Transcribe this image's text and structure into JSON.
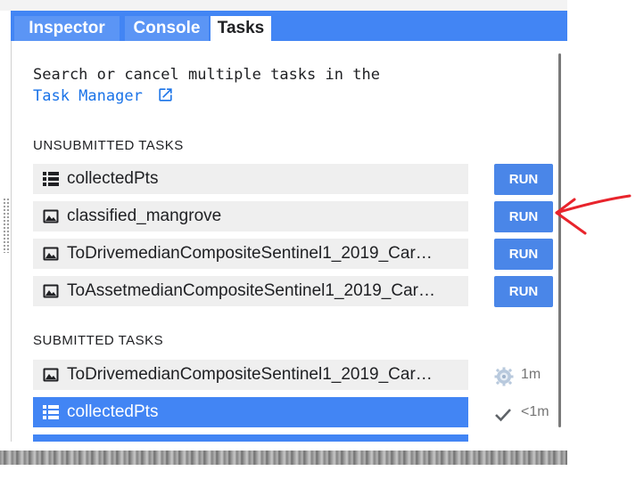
{
  "tabs": [
    {
      "label": "Inspector"
    },
    {
      "label": "Console"
    },
    {
      "label": "Tasks"
    }
  ],
  "intro": {
    "text": "Search or cancel multiple tasks in the",
    "link": "Task Manager"
  },
  "unsubmitted": {
    "title": "UNSUBMITTED TASKS",
    "tasks": [
      {
        "icon": "table-icon",
        "name": "collectedPts",
        "button": "RUN"
      },
      {
        "icon": "image-icon",
        "name": "classified_mangrove",
        "button": "RUN"
      },
      {
        "icon": "image-icon",
        "name": "ToDrivemedianCompositeSentinel1_2019_Car…",
        "button": "RUN"
      },
      {
        "icon": "image-icon",
        "name": "ToAssetmedianCompositeSentinel1_2019_Car…",
        "button": "RUN"
      }
    ]
  },
  "submitted": {
    "title": "SUBMITTED TASKS",
    "tasks": [
      {
        "icon": "image-icon",
        "name": "ToDrivemedianCompositeSentinel1_2019_Car…",
        "status_icon": "spinner-gear-icon",
        "time": "1m"
      },
      {
        "icon": "table-icon",
        "name": "collectedPts",
        "status_icon": "checkmark-icon",
        "time": "<1m"
      }
    ]
  },
  "colors": {
    "accent": "#4285f4",
    "run_button": "#4a86e8",
    "annotation_arrow": "#e8242c"
  }
}
